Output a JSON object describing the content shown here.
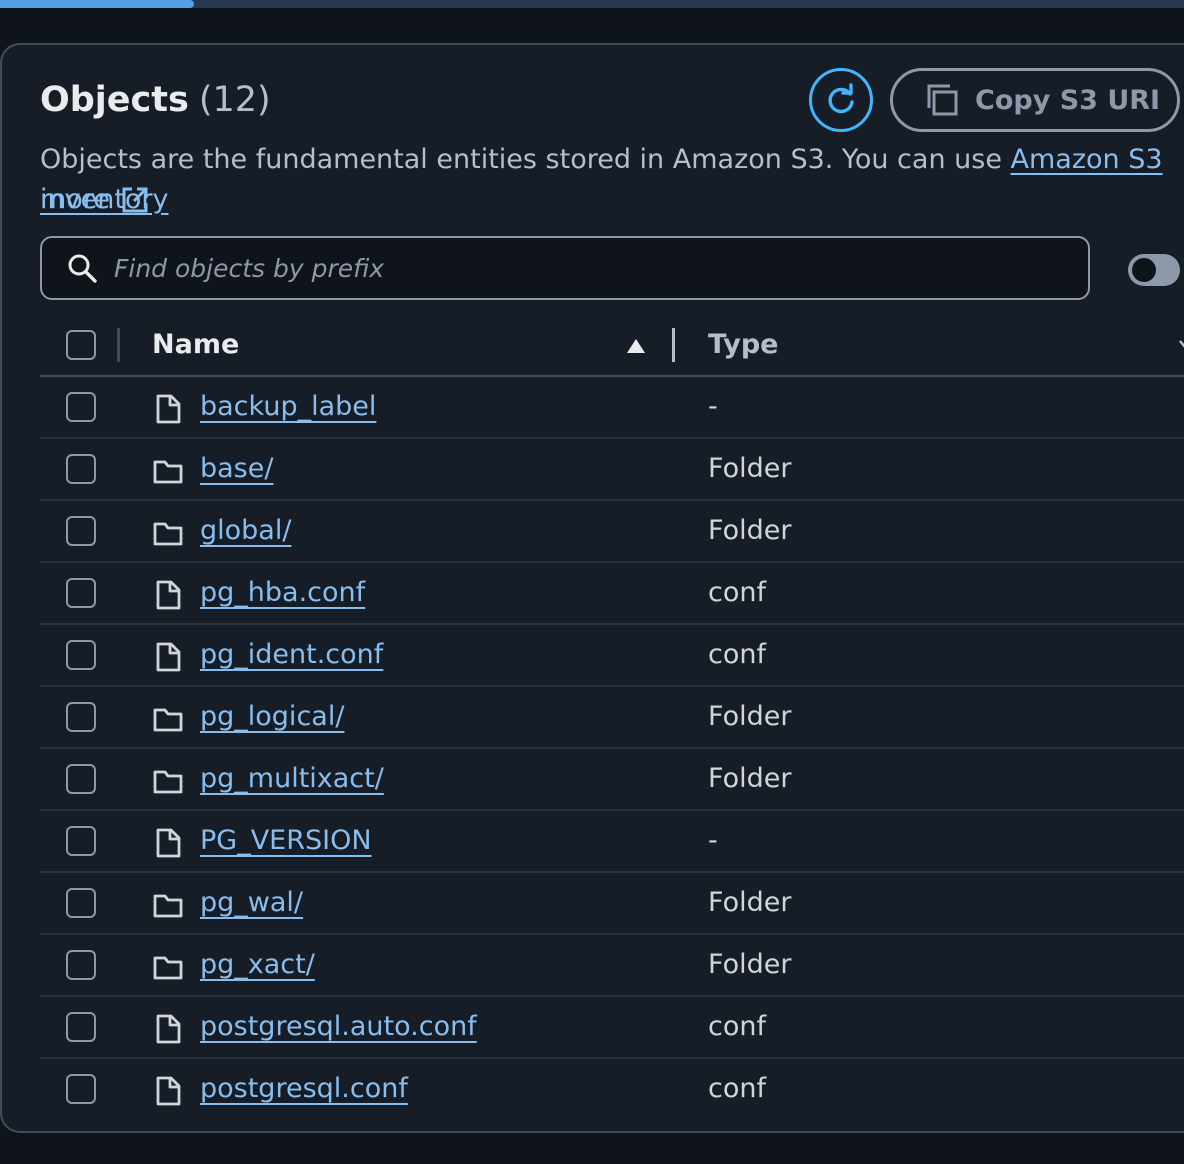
{
  "progress": {
    "fraction": 0.164
  },
  "header": {
    "title": "Objects",
    "count": "(12)",
    "copy_button_label": "Copy S3 URI"
  },
  "description": {
    "text": "Objects are the fundamental entities stored in Amazon S3. You can use ",
    "link_text": "Amazon S3 inventory",
    "more_link": "more"
  },
  "search": {
    "placeholder": "Find objects by prefix",
    "value": ""
  },
  "table": {
    "columns": [
      "Name",
      "Type"
    ],
    "rows": [
      {
        "name": "backup_label",
        "type": "-",
        "icon": "file-icon"
      },
      {
        "name": "base/",
        "type": "Folder",
        "icon": "folder-icon"
      },
      {
        "name": "global/",
        "type": "Folder",
        "icon": "folder-icon"
      },
      {
        "name": "pg_hba.conf",
        "type": "conf",
        "icon": "file-icon"
      },
      {
        "name": "pg_ident.conf",
        "type": "conf",
        "icon": "file-icon"
      },
      {
        "name": "pg_logical/",
        "type": "Folder",
        "icon": "folder-icon"
      },
      {
        "name": "pg_multixact/",
        "type": "Folder",
        "icon": "folder-icon"
      },
      {
        "name": "PG_VERSION",
        "type": "-",
        "icon": "file-icon"
      },
      {
        "name": "pg_wal/",
        "type": "Folder",
        "icon": "folder-icon"
      },
      {
        "name": "pg_xact/",
        "type": "Folder",
        "icon": "folder-icon"
      },
      {
        "name": "postgresql.auto.conf",
        "type": "conf",
        "icon": "file-icon"
      },
      {
        "name": "postgresql.conf",
        "type": "conf",
        "icon": "file-icon"
      }
    ]
  },
  "colors": {
    "link": "#89bdee",
    "accent": "#42b4ff",
    "background": "#161d26"
  }
}
